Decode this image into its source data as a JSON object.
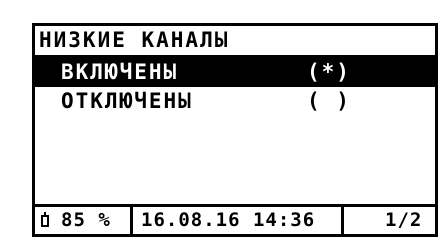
{
  "screen": {
    "title": "НИЗКИЕ КАНАЛЫ",
    "options": [
      {
        "label": "ВКЛЮЧЕНЫ",
        "mark": "(*)",
        "selected": true
      },
      {
        "label": "ОТКЛЮЧЕНЫ",
        "mark": "( )",
        "selected": false
      }
    ]
  },
  "status_bar": {
    "battery_icon": "battery-icon",
    "battery_percent": "85 %",
    "datetime": "16.08.16 14:36",
    "page": "1/2"
  }
}
